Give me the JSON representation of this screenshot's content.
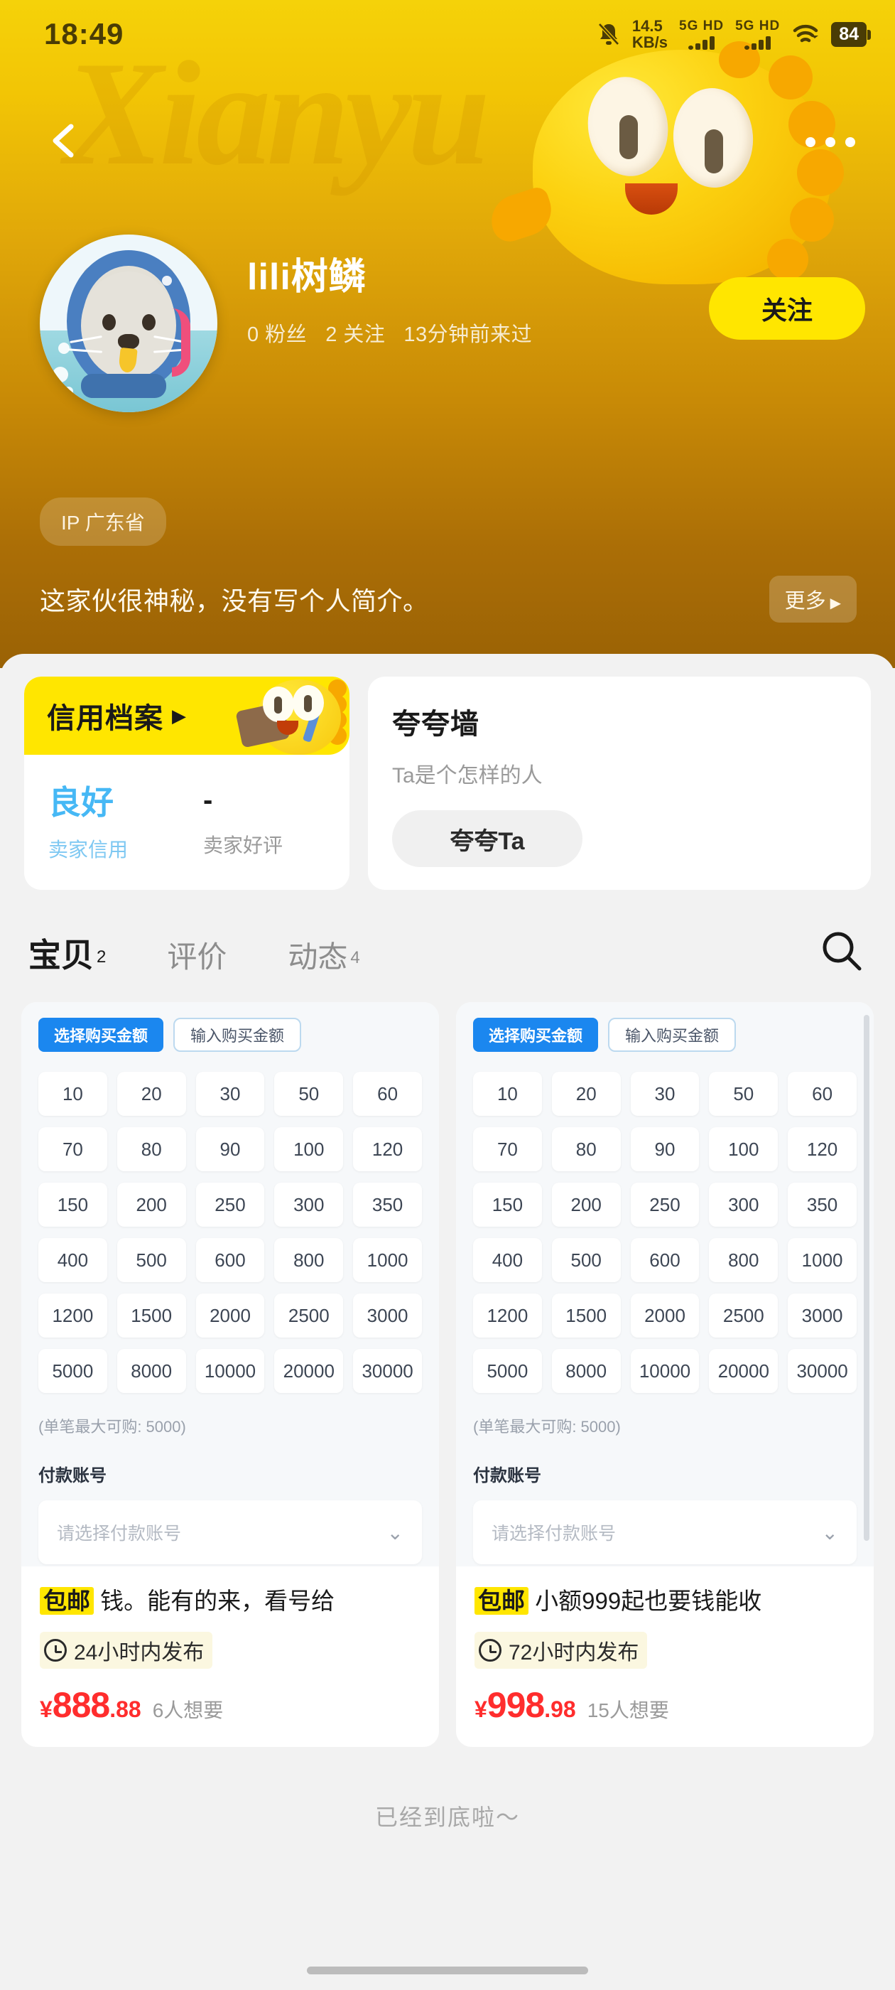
{
  "statusbar": {
    "time": "18:49",
    "mute_icon": "bell-muted-icon",
    "net_speed": "14.5",
    "net_speed_unit": "KB/s",
    "sim1_label": "5G HD",
    "sim2_label": "5G HD",
    "wifi_icon": "wifi-icon",
    "battery": "84"
  },
  "header": {
    "back_icon": "back-chevron-icon",
    "more_icon": "more-dots-icon",
    "watermark": "Xianyu",
    "avatar_icon": "user-avatar",
    "username": "lili树鳞",
    "stats": [
      "0 粉丝",
      "2 关注",
      "13分钟前来过"
    ],
    "follow_label": "关注",
    "ip_badge": "IP 广东省",
    "bio": "这家伙很神秘，没有写个人简介。",
    "more_label": "更多",
    "more_arrow": "▶"
  },
  "credit_card": {
    "header_title": "信用档案",
    "header_arrow": "▶",
    "mascot_icon": "xianyu-mascot-icon",
    "metrics": [
      {
        "value": "良好",
        "label": "卖家信用"
      },
      {
        "value": "-",
        "label": "卖家好评"
      }
    ]
  },
  "praise_card": {
    "title": "夸夸墙",
    "subtitle": "Ta是个怎样的人",
    "button_label": "夸夸Ta"
  },
  "tabs": {
    "items": [
      {
        "label": "宝贝",
        "count": "2",
        "active": true
      },
      {
        "label": "评价",
        "count": "",
        "active": false
      },
      {
        "label": "动态",
        "count": "4",
        "active": false
      }
    ],
    "search_icon": "search-icon"
  },
  "products": [
    {
      "thumbnail": {
        "seg_on": "选择购买金额",
        "seg_off": "输入购买金额",
        "amounts": [
          "10",
          "20",
          "30",
          "50",
          "60",
          "70",
          "80",
          "90",
          "100",
          "120",
          "150",
          "200",
          "250",
          "300",
          "350",
          "400",
          "500",
          "600",
          "800",
          "1000",
          "1200",
          "1500",
          "2000",
          "2500",
          "3000",
          "5000",
          "8000",
          "10000",
          "20000",
          "30000"
        ],
        "max_note": "(单笔最大可购: 5000)",
        "pay_label": "付款账号",
        "pay_placeholder": "请选择付款账号",
        "chevron": "⌄"
      },
      "badge": "包邮",
      "title": "钱。能有的来，看号给",
      "time_icon": "clock-icon",
      "time_text": "24小时内发布",
      "currency": "¥",
      "price_int": "888",
      "price_dec": ".88",
      "want_text": "6人想要"
    },
    {
      "thumbnail": {
        "seg_on": "选择购买金额",
        "seg_off": "输入购买金额",
        "amounts": [
          "10",
          "20",
          "30",
          "50",
          "60",
          "70",
          "80",
          "90",
          "100",
          "120",
          "150",
          "200",
          "250",
          "300",
          "350",
          "400",
          "500",
          "600",
          "800",
          "1000",
          "1200",
          "1500",
          "2000",
          "2500",
          "3000",
          "5000",
          "8000",
          "10000",
          "20000",
          "30000"
        ],
        "max_note": "(单笔最大可购: 5000)",
        "pay_label": "付款账号",
        "pay_placeholder": "请选择付款账号",
        "chevron": "⌄"
      },
      "badge": "包邮",
      "title": "小额999起也要钱能收",
      "time_icon": "clock-icon",
      "time_text": "72小时内发布",
      "currency": "¥",
      "price_int": "998",
      "price_dec": ".98",
      "want_text": "15人想要"
    }
  ],
  "footer": {
    "end_text": "已经到底啦～"
  },
  "colors": {
    "brand_yellow": "#ffe600",
    "header_top": "#f5d209",
    "header_bottom": "#9a6205",
    "price_red": "#ff2d2d",
    "credit_blue": "#46b8f5",
    "seg_blue": "#1b87ef"
  }
}
